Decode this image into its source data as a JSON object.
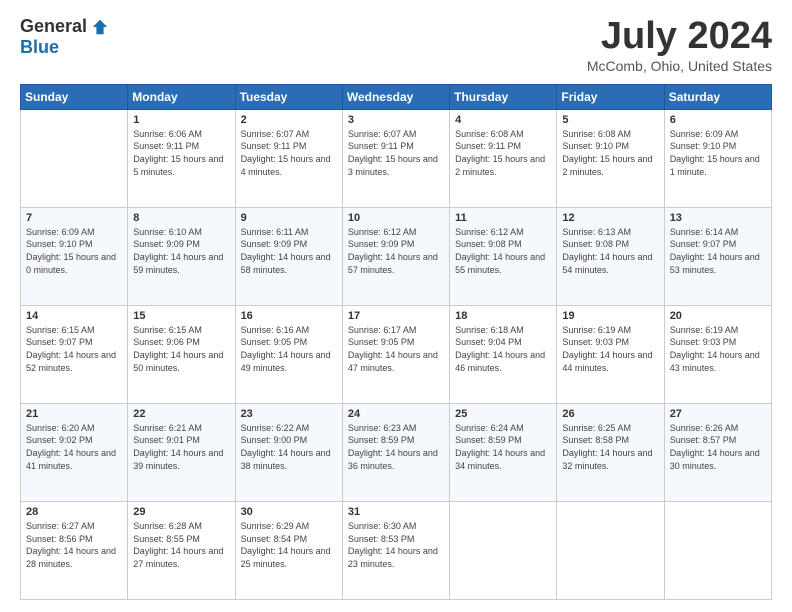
{
  "logo": {
    "general": "General",
    "blue": "Blue"
  },
  "title": "July 2024",
  "location": "McComb, Ohio, United States",
  "days_of_week": [
    "Sunday",
    "Monday",
    "Tuesday",
    "Wednesday",
    "Thursday",
    "Friday",
    "Saturday"
  ],
  "weeks": [
    [
      {
        "day": "",
        "sunrise": "",
        "sunset": "",
        "daylight": ""
      },
      {
        "day": "1",
        "sunrise": "Sunrise: 6:06 AM",
        "sunset": "Sunset: 9:11 PM",
        "daylight": "Daylight: 15 hours and 5 minutes."
      },
      {
        "day": "2",
        "sunrise": "Sunrise: 6:07 AM",
        "sunset": "Sunset: 9:11 PM",
        "daylight": "Daylight: 15 hours and 4 minutes."
      },
      {
        "day": "3",
        "sunrise": "Sunrise: 6:07 AM",
        "sunset": "Sunset: 9:11 PM",
        "daylight": "Daylight: 15 hours and 3 minutes."
      },
      {
        "day": "4",
        "sunrise": "Sunrise: 6:08 AM",
        "sunset": "Sunset: 9:11 PM",
        "daylight": "Daylight: 15 hours and 2 minutes."
      },
      {
        "day": "5",
        "sunrise": "Sunrise: 6:08 AM",
        "sunset": "Sunset: 9:10 PM",
        "daylight": "Daylight: 15 hours and 2 minutes."
      },
      {
        "day": "6",
        "sunrise": "Sunrise: 6:09 AM",
        "sunset": "Sunset: 9:10 PM",
        "daylight": "Daylight: 15 hours and 1 minute."
      }
    ],
    [
      {
        "day": "7",
        "sunrise": "Sunrise: 6:09 AM",
        "sunset": "Sunset: 9:10 PM",
        "daylight": "Daylight: 15 hours and 0 minutes."
      },
      {
        "day": "8",
        "sunrise": "Sunrise: 6:10 AM",
        "sunset": "Sunset: 9:09 PM",
        "daylight": "Daylight: 14 hours and 59 minutes."
      },
      {
        "day": "9",
        "sunrise": "Sunrise: 6:11 AM",
        "sunset": "Sunset: 9:09 PM",
        "daylight": "Daylight: 14 hours and 58 minutes."
      },
      {
        "day": "10",
        "sunrise": "Sunrise: 6:12 AM",
        "sunset": "Sunset: 9:09 PM",
        "daylight": "Daylight: 14 hours and 57 minutes."
      },
      {
        "day": "11",
        "sunrise": "Sunrise: 6:12 AM",
        "sunset": "Sunset: 9:08 PM",
        "daylight": "Daylight: 14 hours and 55 minutes."
      },
      {
        "day": "12",
        "sunrise": "Sunrise: 6:13 AM",
        "sunset": "Sunset: 9:08 PM",
        "daylight": "Daylight: 14 hours and 54 minutes."
      },
      {
        "day": "13",
        "sunrise": "Sunrise: 6:14 AM",
        "sunset": "Sunset: 9:07 PM",
        "daylight": "Daylight: 14 hours and 53 minutes."
      }
    ],
    [
      {
        "day": "14",
        "sunrise": "Sunrise: 6:15 AM",
        "sunset": "Sunset: 9:07 PM",
        "daylight": "Daylight: 14 hours and 52 minutes."
      },
      {
        "day": "15",
        "sunrise": "Sunrise: 6:15 AM",
        "sunset": "Sunset: 9:06 PM",
        "daylight": "Daylight: 14 hours and 50 minutes."
      },
      {
        "day": "16",
        "sunrise": "Sunrise: 6:16 AM",
        "sunset": "Sunset: 9:05 PM",
        "daylight": "Daylight: 14 hours and 49 minutes."
      },
      {
        "day": "17",
        "sunrise": "Sunrise: 6:17 AM",
        "sunset": "Sunset: 9:05 PM",
        "daylight": "Daylight: 14 hours and 47 minutes."
      },
      {
        "day": "18",
        "sunrise": "Sunrise: 6:18 AM",
        "sunset": "Sunset: 9:04 PM",
        "daylight": "Daylight: 14 hours and 46 minutes."
      },
      {
        "day": "19",
        "sunrise": "Sunrise: 6:19 AM",
        "sunset": "Sunset: 9:03 PM",
        "daylight": "Daylight: 14 hours and 44 minutes."
      },
      {
        "day": "20",
        "sunrise": "Sunrise: 6:19 AM",
        "sunset": "Sunset: 9:03 PM",
        "daylight": "Daylight: 14 hours and 43 minutes."
      }
    ],
    [
      {
        "day": "21",
        "sunrise": "Sunrise: 6:20 AM",
        "sunset": "Sunset: 9:02 PM",
        "daylight": "Daylight: 14 hours and 41 minutes."
      },
      {
        "day": "22",
        "sunrise": "Sunrise: 6:21 AM",
        "sunset": "Sunset: 9:01 PM",
        "daylight": "Daylight: 14 hours and 39 minutes."
      },
      {
        "day": "23",
        "sunrise": "Sunrise: 6:22 AM",
        "sunset": "Sunset: 9:00 PM",
        "daylight": "Daylight: 14 hours and 38 minutes."
      },
      {
        "day": "24",
        "sunrise": "Sunrise: 6:23 AM",
        "sunset": "Sunset: 8:59 PM",
        "daylight": "Daylight: 14 hours and 36 minutes."
      },
      {
        "day": "25",
        "sunrise": "Sunrise: 6:24 AM",
        "sunset": "Sunset: 8:59 PM",
        "daylight": "Daylight: 14 hours and 34 minutes."
      },
      {
        "day": "26",
        "sunrise": "Sunrise: 6:25 AM",
        "sunset": "Sunset: 8:58 PM",
        "daylight": "Daylight: 14 hours and 32 minutes."
      },
      {
        "day": "27",
        "sunrise": "Sunrise: 6:26 AM",
        "sunset": "Sunset: 8:57 PM",
        "daylight": "Daylight: 14 hours and 30 minutes."
      }
    ],
    [
      {
        "day": "28",
        "sunrise": "Sunrise: 6:27 AM",
        "sunset": "Sunset: 8:56 PM",
        "daylight": "Daylight: 14 hours and 28 minutes."
      },
      {
        "day": "29",
        "sunrise": "Sunrise: 6:28 AM",
        "sunset": "Sunset: 8:55 PM",
        "daylight": "Daylight: 14 hours and 27 minutes."
      },
      {
        "day": "30",
        "sunrise": "Sunrise: 6:29 AM",
        "sunset": "Sunset: 8:54 PM",
        "daylight": "Daylight: 14 hours and 25 minutes."
      },
      {
        "day": "31",
        "sunrise": "Sunrise: 6:30 AM",
        "sunset": "Sunset: 8:53 PM",
        "daylight": "Daylight: 14 hours and 23 minutes."
      },
      {
        "day": "",
        "sunrise": "",
        "sunset": "",
        "daylight": ""
      },
      {
        "day": "",
        "sunrise": "",
        "sunset": "",
        "daylight": ""
      },
      {
        "day": "",
        "sunrise": "",
        "sunset": "",
        "daylight": ""
      }
    ]
  ]
}
